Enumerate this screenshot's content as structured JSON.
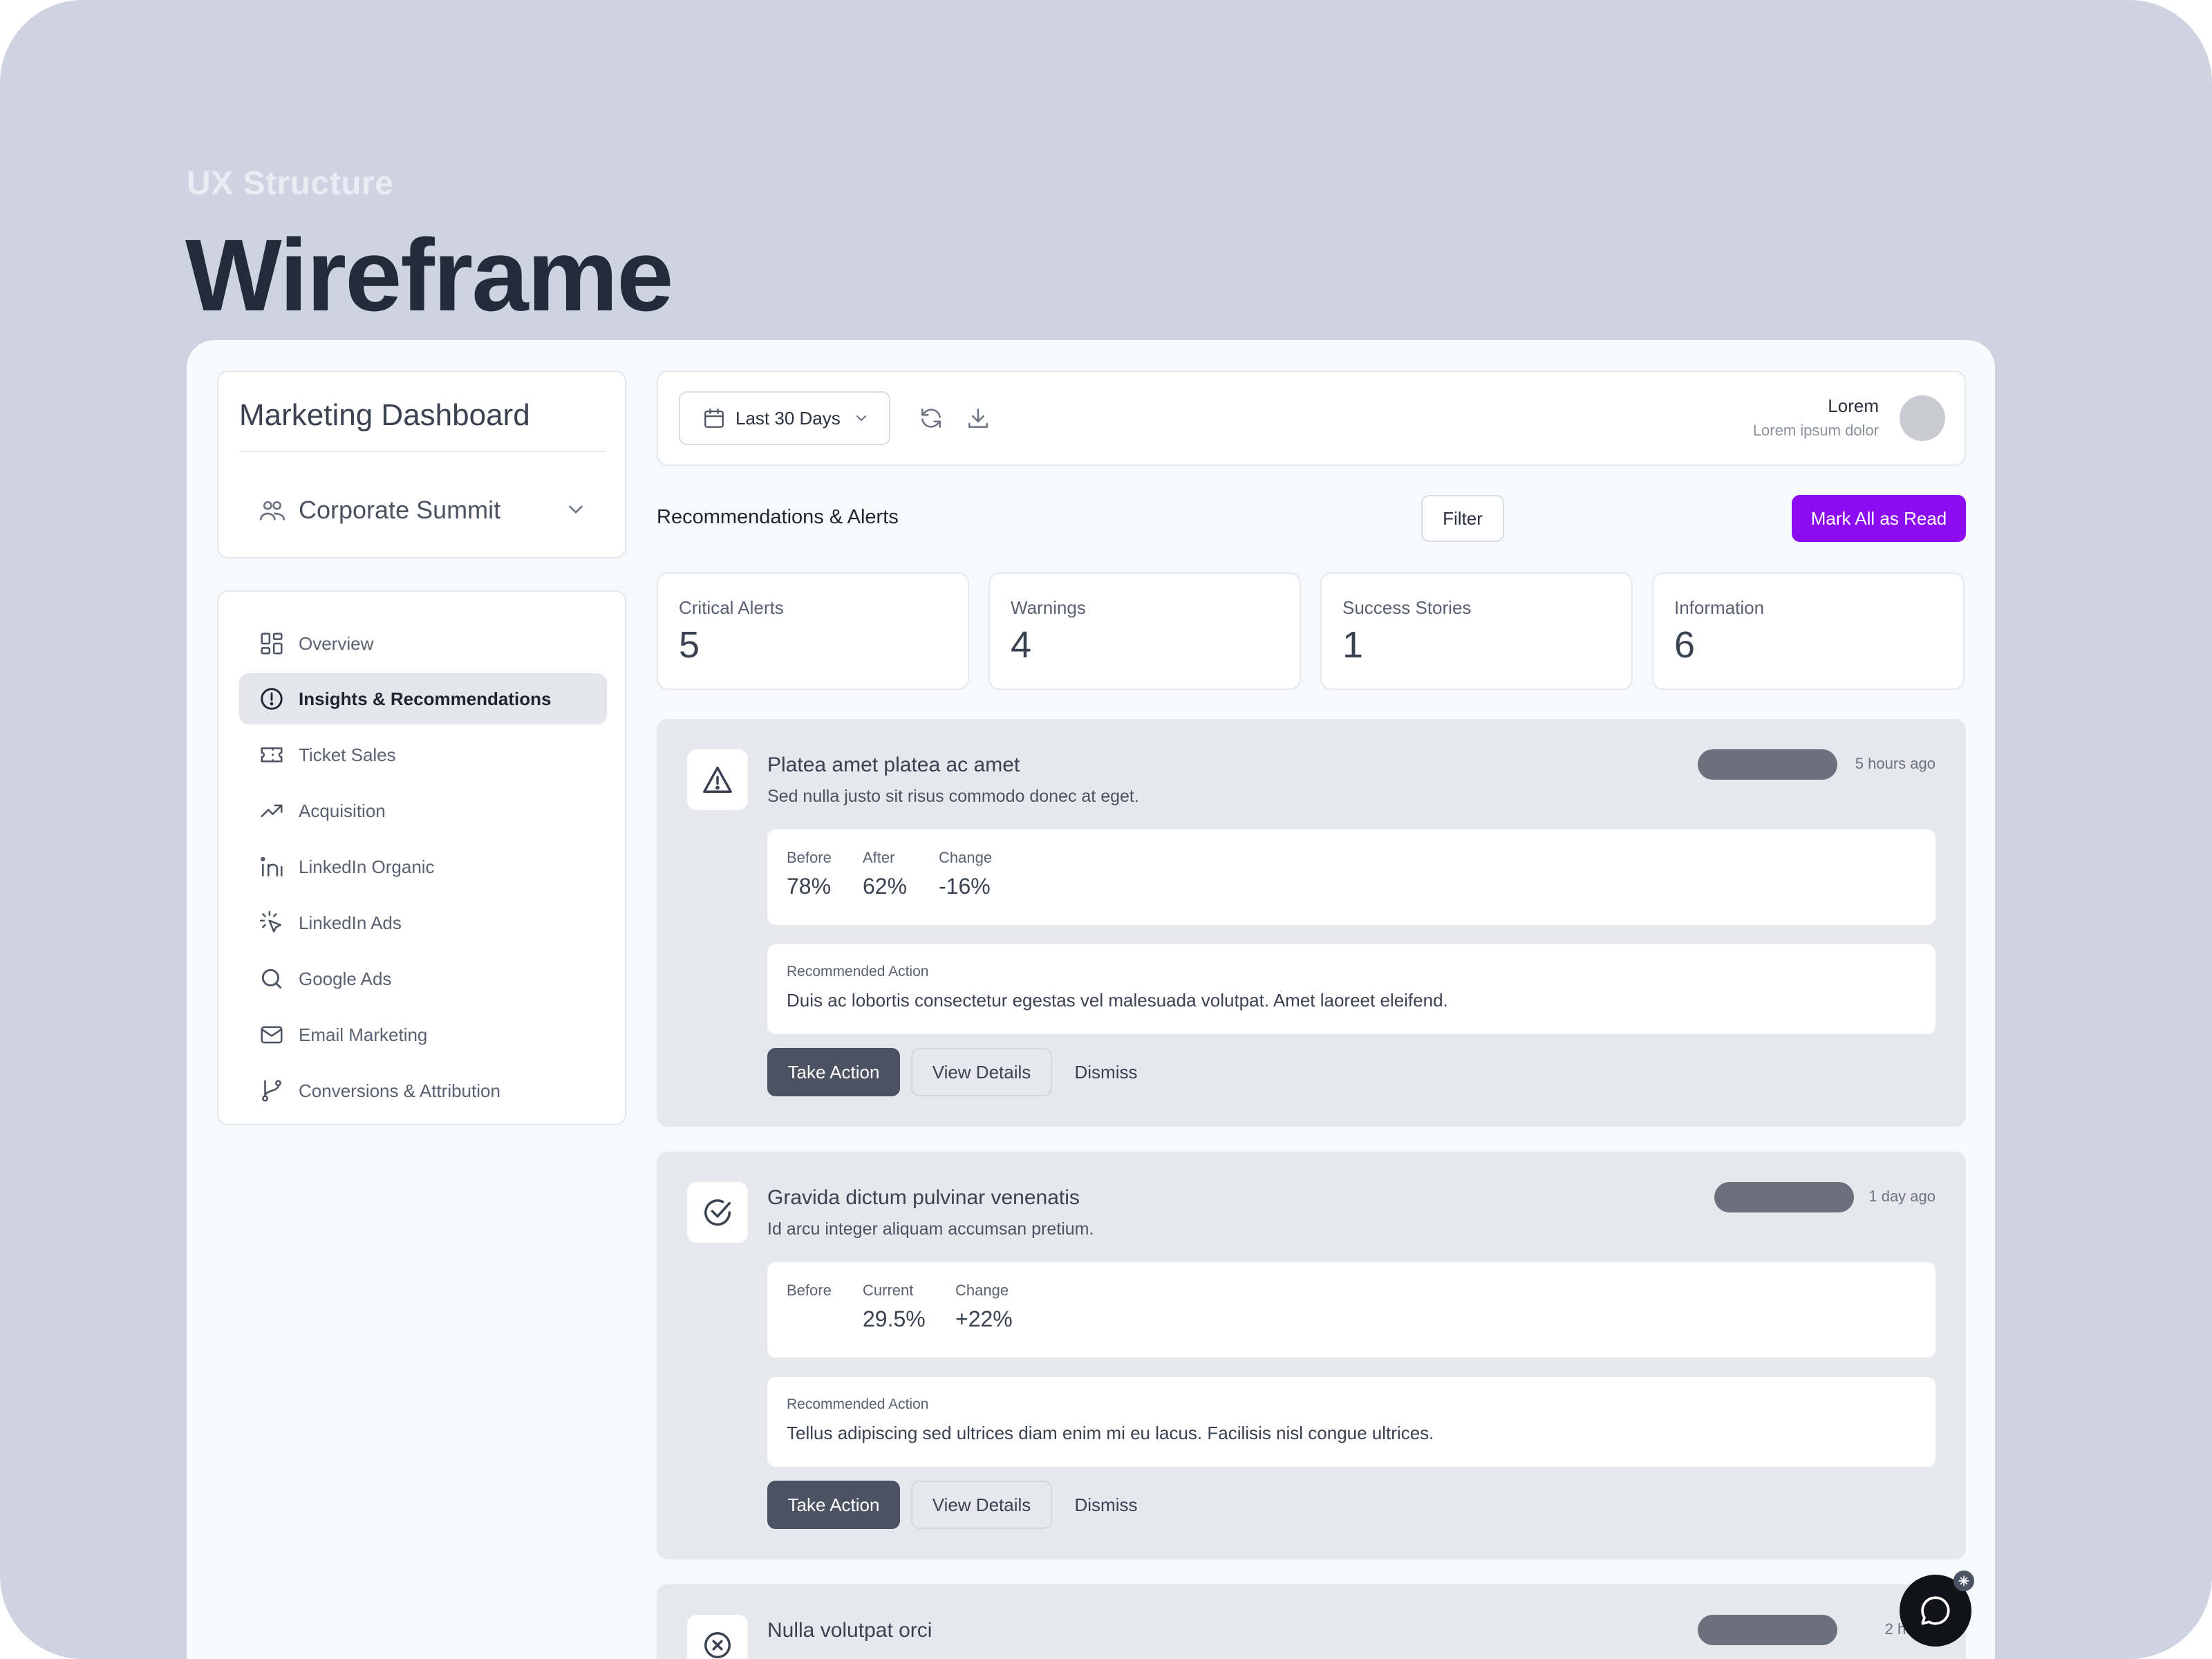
{
  "hero": {
    "eyebrow": "UX Structure",
    "title": "Wireframe"
  },
  "sidebar": {
    "brand": "Marketing Dashboard",
    "event_select": {
      "label": "Corporate Summit",
      "icon": "users-icon"
    },
    "items": [
      {
        "label": "Overview",
        "icon": "grid-icon",
        "active": false
      },
      {
        "label": "Insights & Recommendations",
        "icon": "alert-circle-icon",
        "active": true
      },
      {
        "label": "Ticket Sales",
        "icon": "ticket-icon",
        "active": false
      },
      {
        "label": "Acquisition",
        "icon": "trending-up-icon",
        "active": false
      },
      {
        "label": "LinkedIn Organic",
        "icon": "linkedin-icon",
        "active": false
      },
      {
        "label": "LinkedIn Ads",
        "icon": "cursor-click-icon",
        "active": false
      },
      {
        "label": "Google Ads",
        "icon": "search-icon",
        "active": false
      },
      {
        "label": "Email Marketing",
        "icon": "mail-icon",
        "active": false
      },
      {
        "label": "Conversions & Attribution",
        "icon": "git-branch-icon",
        "active": false
      }
    ]
  },
  "topbar": {
    "date_range": "Last 30 Days",
    "user": {
      "name": "Lorem",
      "subtitle": "Lorem ipsum dolor"
    }
  },
  "section": {
    "title": "Recommendations & Alerts",
    "filter_label": "Filter",
    "mark_read_label": "Mark All as Read"
  },
  "stats": [
    {
      "label": "Critical Alerts",
      "value": "5"
    },
    {
      "label": "Warnings",
      "value": "4"
    },
    {
      "label": "Success Stories",
      "value": "1"
    },
    {
      "label": "Information",
      "value": "6"
    }
  ],
  "alerts": [
    {
      "icon": "warning-triangle-icon",
      "title": "Platea amet platea ac amet",
      "subtitle": "Sed nulla justo sit risus commodo donec at eget.",
      "time": "5 hours ago",
      "metrics": [
        {
          "label": "Before",
          "value": "78%"
        },
        {
          "label": "After",
          "value": "62%"
        },
        {
          "label": "Change",
          "value": "-16%"
        }
      ],
      "action_label": "Recommended Action",
      "action_text": "Duis ac lobortis consectetur egestas vel malesuada volutpat. Amet laoreet eleifend."
    },
    {
      "icon": "check-circle-icon",
      "title": "Gravida dictum pulvinar venenatis",
      "subtitle": "Id arcu integer aliquam accumsan pretium.",
      "time": "1 day ago",
      "metrics": [
        {
          "label": "Before",
          "value": ""
        },
        {
          "label": "Current",
          "value": "29.5%"
        },
        {
          "label": "Change",
          "value": "+22%"
        }
      ],
      "action_label": "Recommended Action",
      "action_text": "Tellus adipiscing sed ultrices diam enim mi eu lacus. Facilisis nisl congue ultrices."
    },
    {
      "icon": "x-circle-icon",
      "title": "Nulla volutpat orci",
      "time": "2 hours"
    }
  ],
  "buttons": {
    "take_action": "Take Action",
    "view_details": "View Details",
    "dismiss": "Dismiss"
  }
}
